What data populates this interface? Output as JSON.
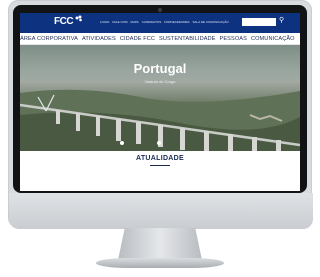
{
  "brand": {
    "logo_text": "FCC"
  },
  "top_links": [
    "LOGIN",
    "FALE COM",
    "MAPA",
    "CANDIDATOS",
    "FORNECEDORES",
    "SALA DE COMUNICAÇÃO"
  ],
  "main_nav": [
    "ÁREA CORPORATIVA",
    "ATIVIDADES",
    "CIDADE FCC",
    "SUSTENTABILIDADE",
    "PESSOAS",
    "COMUNICAÇÃO"
  ],
  "hero": {
    "title": "Portugal",
    "subtitle": "Viaduto do Corgo"
  },
  "news": {
    "title": "ATUALIDADE"
  },
  "colors": {
    "brand_blue": "#0d3280",
    "text_navy": "#1b2b55"
  }
}
